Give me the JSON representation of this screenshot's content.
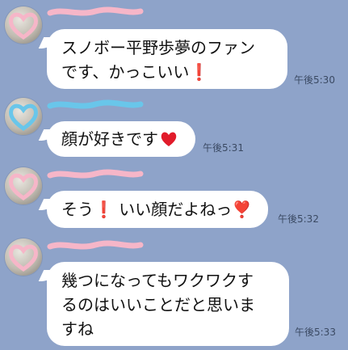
{
  "colors": {
    "background": "#8ea3c9",
    "bubble": "#ffffff",
    "timestamp": "#3b4a63",
    "heart_pink": "#f6b6c8",
    "heart_blue": "#69c6ea",
    "exclaim_red": "#e11b2a"
  },
  "messages": [
    {
      "sender_avatar_icon": "pink-heart-icon",
      "line1": "スノボー平野歩夢のファン",
      "line2": "です、かっこいい",
      "trailing_emoji": "❗",
      "time": "午後5:30"
    },
    {
      "sender_avatar_icon": "blue-heart-icon",
      "text": "顔が好きです",
      "trailing_emoji": "red-heart",
      "time": "午後5:31"
    },
    {
      "sender_avatar_icon": "pink-heart-icon",
      "part1": "そう",
      "mid_emoji": "❗",
      "part2": "いい顔だよねっ",
      "trailing_emoji": "❣️",
      "time": "午後5:32"
    },
    {
      "sender_avatar_icon": "pink-heart-icon",
      "line1": "幾つになってもワクワクす",
      "line2": "るのはいいことだと思いま",
      "line3": "すね",
      "time": "午後5:33"
    }
  ]
}
